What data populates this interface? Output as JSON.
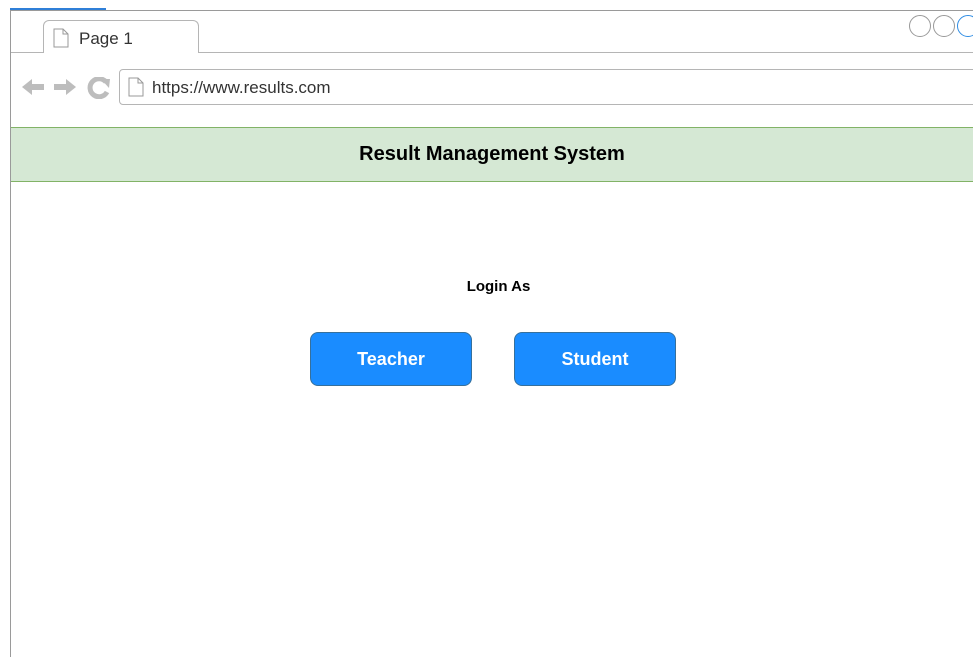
{
  "browser": {
    "tab_label": "Page 1",
    "url": "https://www.results.com"
  },
  "page": {
    "header_title": "Result Management System",
    "login_label": "Login As",
    "teacher_button": "Teacher",
    "student_button": "Student"
  },
  "colors": {
    "header_band": "#d5e8d4",
    "header_border": "#82b366",
    "button_fill": "#1a8cff",
    "accent": "#2f7fd8"
  },
  "icons": {
    "back": "arrow-left-icon",
    "forward": "arrow-right-icon",
    "reload": "reload-icon",
    "page": "page-icon"
  }
}
